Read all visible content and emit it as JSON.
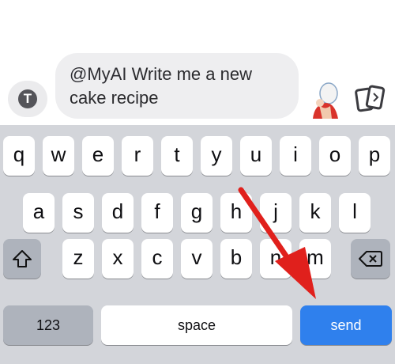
{
  "compose": {
    "mention": "@MyAI",
    "text": " Write me a new cake recipe"
  },
  "keyboard": {
    "row1": [
      "q",
      "w",
      "e",
      "r",
      "t",
      "y",
      "u",
      "i",
      "o",
      "p"
    ],
    "row2": [
      "a",
      "s",
      "d",
      "f",
      "g",
      "h",
      "j",
      "k",
      "l"
    ],
    "row3": [
      "z",
      "x",
      "c",
      "v",
      "b",
      "n",
      "m"
    ],
    "numbers_label": "123",
    "space_label": "space",
    "send_label": "send"
  },
  "icons": {
    "tools": "t-icon",
    "avatar": "bitmoji-avatar-icon",
    "cards": "cards-icon",
    "shift": "shift-icon",
    "delete": "backspace-icon"
  },
  "colors": {
    "send_key": "#2f80ed",
    "keyboard_bg": "#d3d5da",
    "annotation_arrow": "#e0201c"
  }
}
